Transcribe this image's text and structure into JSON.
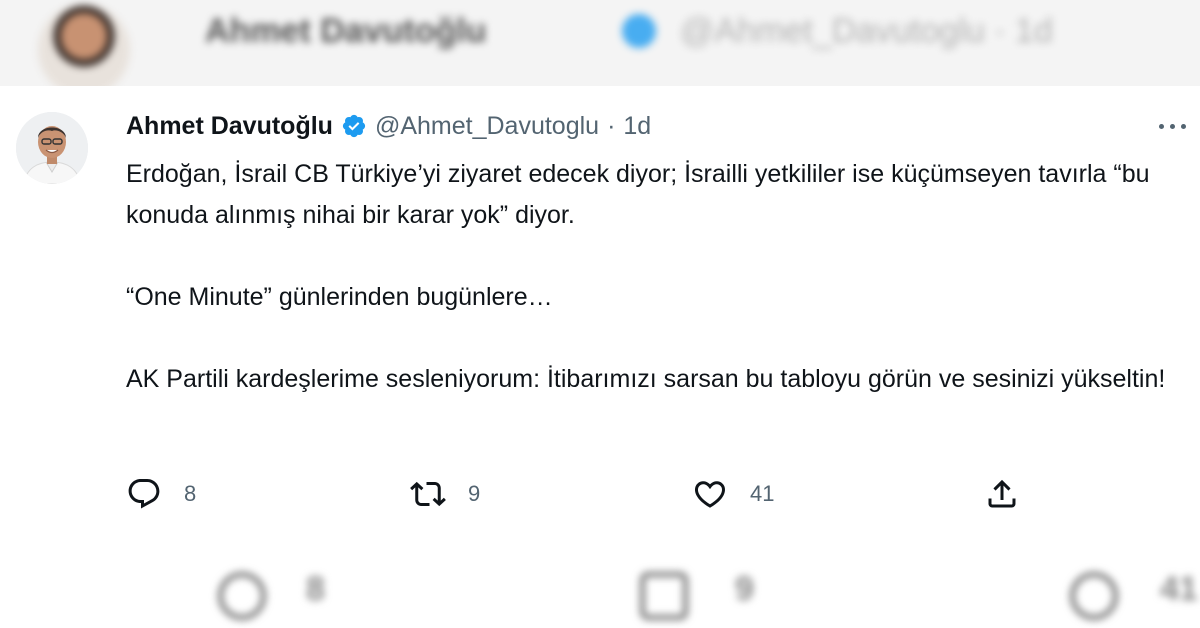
{
  "background": {
    "top_name": "Ahmet Davutoğlu",
    "top_handle": "@Ahmet_Davutoglu · 1d",
    "bottom_counts": [
      "8",
      "9",
      "41"
    ]
  },
  "tweet": {
    "author_name": "Ahmet Davutoğlu",
    "handle": "@Ahmet_Davutoglu",
    "separator": "·",
    "time": "1d",
    "paragraphs": [
      "Erdoğan, İsrail CB Türkiye’yi ziyaret edecek diyor; İsrailli yetkililer ise küçümseyen tavırla “bu konuda alınmış nihai bir karar yok” diyor.",
      "“One Minute” günlerinden bugünlere…",
      "AK Partili kardeşlerime sesleniyorum: İtibarımızı sarsan bu tabloyu görün ve sesinizi yükseltin!"
    ],
    "replies": "8",
    "retweets": "9",
    "likes": "41"
  },
  "icons": {
    "reply": "reply-icon",
    "retweet": "retweet-icon",
    "like": "heart-icon",
    "share": "share-icon",
    "more": "more-icon",
    "verified": "verified-badge-icon"
  },
  "colors": {
    "text": "#0f1419",
    "secondary": "#536471",
    "verified": "#1d9bf0"
  }
}
